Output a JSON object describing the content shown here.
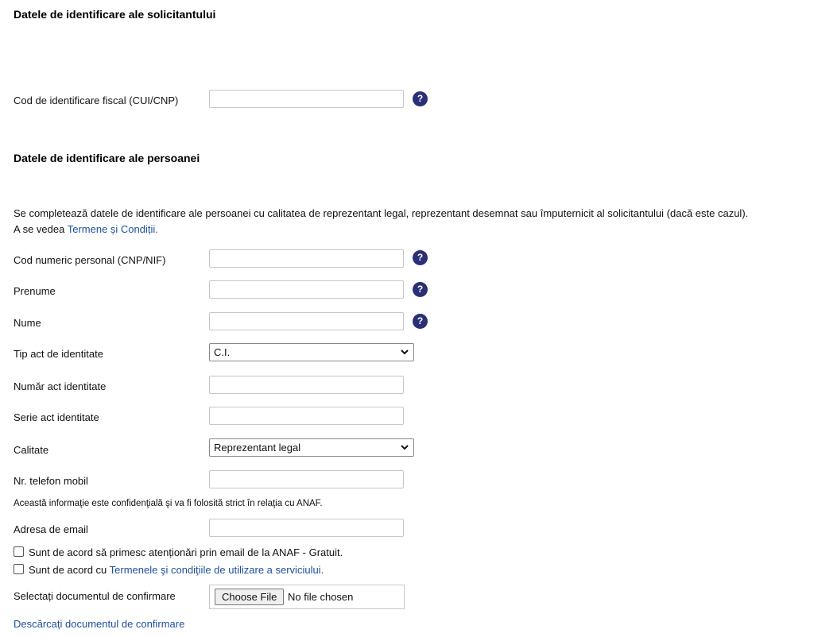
{
  "section_applicant": {
    "title": "Datele de identificare ale solicitantului",
    "cui_label": "Cod de identificare fiscal (CUI/CNP)",
    "cui_value": ""
  },
  "section_person": {
    "title": "Datele de identificare ale persoanei",
    "intro_line1": "Se completează datele de identificare ale persoanei cu calitatea de reprezentant legal, reprezentant desemnat sau împuternicit al solicitantului (dacă este cazul).",
    "intro_line2_prefix": "A se vedea ",
    "intro_link": "Termene și Condiții."
  },
  "fields": {
    "cnp_label": "Cod numeric personal (CNP/NIF)",
    "prenume_label": "Prenume",
    "nume_label": "Nume",
    "tip_act_label": "Tip act de identitate",
    "tip_act_value": "C.I.",
    "numar_act_label": "Număr act identitate",
    "serie_act_label": "Serie act identitate",
    "calitate_label": "Calitate",
    "calitate_value": "Reprezentant legal",
    "telefon_label": "Nr. telefon mobil",
    "confidential_note": "Această informaţie este confidenţială şi va fi folosită strict în relaţia cu ANAF.",
    "email_label": "Adresa de email"
  },
  "help_glyph": "?",
  "checkboxes": {
    "alerts_label": "Sunt de acord să primesc atenționări prin email de la ANAF - Gratuit.",
    "terms_prefix": "Sunt de acord cu ",
    "terms_link": "Termenele şi condiţiile de utilizare a serviciului."
  },
  "upload": {
    "label": "Selectați documentul de confirmare",
    "button": "Choose File",
    "status": "No file chosen"
  },
  "download_link": "Descărcați documentul de confirmare",
  "colors": {
    "help_bg": "#2b2f77",
    "link": "#1f4f9e"
  }
}
